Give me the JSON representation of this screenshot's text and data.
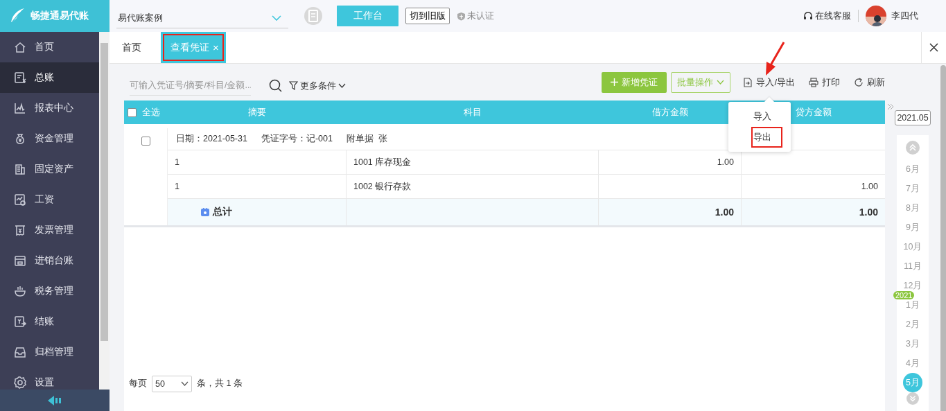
{
  "app": {
    "logo": "畅捷通易代账"
  },
  "sidebar": {
    "items": [
      {
        "label": "首页",
        "selected": false
      },
      {
        "label": "总账",
        "selected": true
      },
      {
        "label": "报表中心",
        "selected": false
      },
      {
        "label": "资金管理",
        "selected": false
      },
      {
        "label": "固定资产",
        "selected": false
      },
      {
        "label": "工资",
        "selected": false
      },
      {
        "label": "发票管理",
        "selected": false
      },
      {
        "label": "进销台账",
        "selected": false
      },
      {
        "label": "税务管理",
        "selected": false
      },
      {
        "label": "结账",
        "selected": false
      },
      {
        "label": "归档管理",
        "selected": false
      },
      {
        "label": "设置",
        "selected": false
      }
    ]
  },
  "header": {
    "company": "易代账案例",
    "workbench_button": "工作台",
    "switch_button": "切到旧版",
    "certification": "未认证",
    "support": "在线客服",
    "user": "李四代"
  },
  "tabs": [
    {
      "label": "首页",
      "selected": false,
      "highlighted": false
    },
    {
      "label": "查看凭证",
      "selected": true,
      "highlighted": true,
      "close": "×"
    }
  ],
  "toolbar": {
    "search": {
      "placeholder": "可输入凭证号/摘要/科目/金额..."
    },
    "filter": "更多条件",
    "buttons": [
      {
        "label": "新增凭证",
        "kind": "primary"
      },
      {
        "label": "批量操作",
        "kind": "outline"
      },
      {
        "label": "导入/导出",
        "kind": "link"
      },
      {
        "label": "打印",
        "kind": "link"
      },
      {
        "label": "刷新",
        "kind": "link"
      }
    ]
  },
  "dropdown": {
    "items": [
      {
        "label": "导入",
        "highlighted": false
      },
      {
        "label": "导出",
        "highlighted": true
      }
    ]
  },
  "table": {
    "select_all": {
      "label": "全选",
      "checked": false
    },
    "columns": [
      "摘要",
      "科目",
      "借方金额",
      "贷方金额"
    ],
    "vouchers": [
      {
        "checked": false,
        "date": "日期：2021-05-31",
        "number": "凭证字号：记-001",
        "attachments": "附单据  张",
        "rows": [
          {
            "summary": "1",
            "account": "1001 库存现金",
            "debit": "1.00"
          },
          {
            "summary": "1",
            "account": "1002 银行存款",
            "credit": "1.00"
          }
        ],
        "total": {
          "label": "总计",
          "debit": "1.00",
          "credit": "1.00"
        }
      }
    ]
  },
  "pagination": {
    "per_page_label": "每页",
    "page_size": "50",
    "summary": "条，共 1 条"
  },
  "calendar": {
    "current": "2021.05",
    "months": [
      {
        "label": "6月",
        "selected": false
      },
      {
        "label": "7月",
        "selected": false
      },
      {
        "label": "8月",
        "selected": false
      },
      {
        "label": "9月",
        "selected": false
      },
      {
        "label": "10月",
        "selected": false
      },
      {
        "label": "11月",
        "selected": false
      },
      {
        "label": "12月",
        "selected": false
      },
      {
        "label": "1月",
        "selected": false,
        "year": "2021"
      },
      {
        "label": "2月",
        "selected": false
      },
      {
        "label": "3月",
        "selected": false
      },
      {
        "label": "4月",
        "selected": false
      },
      {
        "label": "5月",
        "selected": true
      }
    ]
  }
}
